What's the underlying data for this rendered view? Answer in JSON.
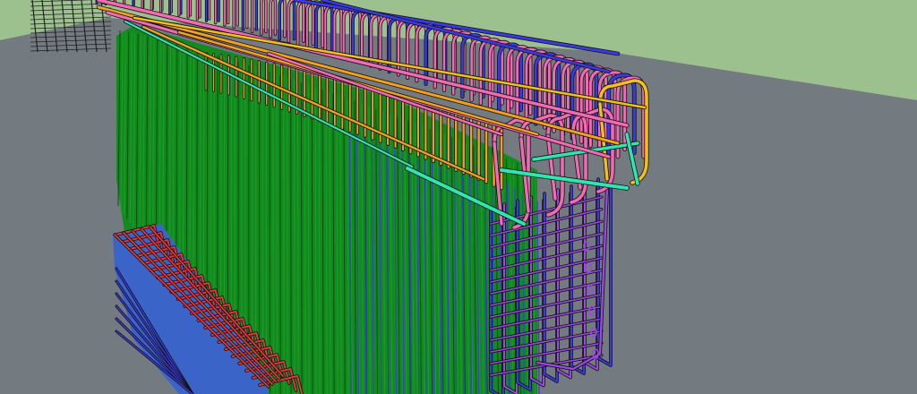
{
  "scene": {
    "subject": "rebar-cage-3d-model",
    "colors": {
      "sky": "#9cc08e",
      "ground": "#737a80",
      "web_green": "#138a1e",
      "web_dark": "#0a4e10",
      "stirrup_blue": "#3a3ae0",
      "stirrup_purple": "#9a4ae0",
      "bar_pink": "#f06ab4",
      "bar_orange": "#f2a21a",
      "bar_yellow": "#f2c01a",
      "bar_teal": "#2ee6b0",
      "bar_red": "#e23a3a",
      "outline": "#111111",
      "distant_frame": "#222222"
    }
  }
}
